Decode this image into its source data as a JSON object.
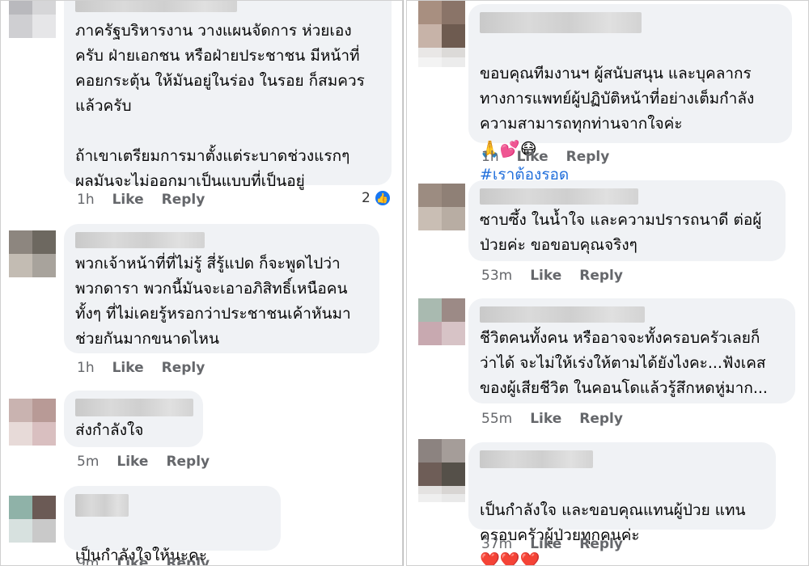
{
  "left": {
    "comments": [
      {
        "text": "ภาครัฐบริหารงาน วางแผนจัดการ ห่วยเอง\nครับ ฝ่ายเอกชน หรือฝ่ายประชาชน มีหน้าที่\nคอยกระตุ้น ให้มันอยู่ในร่อง ในรอย ก็สมควร\nแล้วครับ\n\nถ้าเขาเตรียมการมาตั้งแต่ระบาดช่วงแรกๆ\nผลมันจะไม่ออกมาเป็นแบบที่เป็นอยู่",
        "time": "1h",
        "like": "Like",
        "reply": "Reply",
        "reaction_count": "2"
      },
      {
        "text": "พวกเจ้าหน้าที่ที่ไม่รู้ สี่รู้แปด ก็จะพูดไปว่า\nพวกดารา พวกนี้มันจะเอาอภิสิทธิ์เหนือคน\nทั้งๆ ที่ไม่เคยรู้หรอกว่าประชาชนเค้าหันมา\nช่วยกันมากขนาดไหน",
        "time": "1h",
        "like": "Like",
        "reply": "Reply"
      },
      {
        "text": "ส่งกำลังใจ",
        "time": "5m",
        "like": "Like",
        "reply": "Reply"
      },
      {
        "text": "เป็นกำลังใจให้นะคะ",
        "emoji": "❤️ ✌🏻",
        "time": "9m",
        "like": "Like",
        "reply": "Reply"
      }
    ]
  },
  "right": {
    "comments": [
      {
        "text": "ขอบคุณทีมงานฯ ผู้สนับสนุน และบุคลากร\nทางการแพทย์ผู้ปฏิบัติหน้าที่อย่างเต็มกำลัง\nความสามารถทุกท่านจากใจค่ะ",
        "emoji": "🙏💕😷",
        "hashtag": "#เราต้องรอด",
        "time": "1h",
        "like": "Like",
        "reply": "Reply"
      },
      {
        "text": "ซาบซึ้ง ในน้ำใจ และความปรารถนาดี ต่อผู้\nป่วยค่ะ ขอขอบคุณจริงๆ",
        "time": "53m",
        "like": "Like",
        "reply": "Reply"
      },
      {
        "text": "ชีวิตคนทั้งคน หรืออาจจะทั้งครอบครัวเลยก็\nว่าได้ จะไม่ให้เร่งให้ตามได้ยังไงคะ...ฟังเคส\nของผู้เสียชีวิต ในคอนโดแล้วรู้สึกหดหู่มาก...",
        "time": "55m",
        "like": "Like",
        "reply": "Reply"
      },
      {
        "text": "เป็นกำลังใจ และขอบคุณแทนผู้ป่วย แทน\nครอบครัวผู้ป่วยทุกคนค่ะ",
        "emoji": "❤️❤️❤️",
        "time": "37m",
        "like": "Like",
        "reply": "Reply"
      }
    ]
  },
  "colors": {
    "bubble": "#f0f2f5",
    "meta_text": "#65676b",
    "hashtag": "#216fdb",
    "like_badge": "#1877f2"
  },
  "icons": {
    "reaction": "thumbs-up-icon"
  }
}
